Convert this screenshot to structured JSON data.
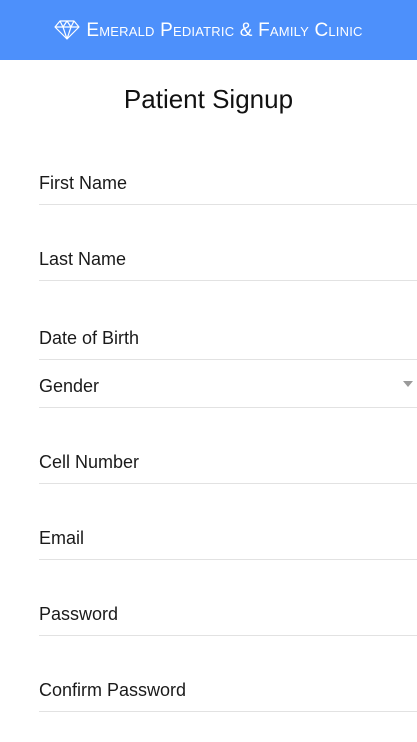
{
  "header": {
    "clinic_name": "Emerald Pediatric & Family Clinic",
    "logo_icon": "diamond-icon",
    "background_color": "#4d90fb"
  },
  "page": {
    "title": "Patient Signup"
  },
  "form": {
    "first_name": {
      "label": "First Name",
      "value": ""
    },
    "last_name": {
      "label": "Last Name",
      "value": ""
    },
    "date_of_birth": {
      "label": "Date of Birth",
      "value": ""
    },
    "gender": {
      "label": "Gender",
      "selected": ""
    },
    "cell_number": {
      "label": "Cell Number",
      "value": ""
    },
    "email": {
      "label": "Email",
      "value": ""
    },
    "password": {
      "label": "Password",
      "value": ""
    },
    "confirm_password": {
      "label": "Confirm Password",
      "value": ""
    }
  }
}
